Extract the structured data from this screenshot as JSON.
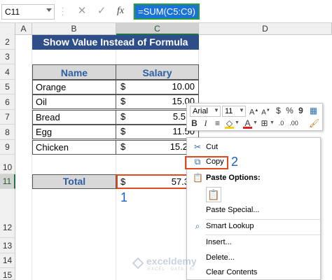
{
  "formula_bar": {
    "name_box": "C11",
    "formula": "=SUM(C5:C9)"
  },
  "columns": [
    "A",
    "B",
    "C",
    "D"
  ],
  "rows": [
    "1",
    "2",
    "3",
    "4",
    "5",
    "6",
    "7",
    "8",
    "9",
    "10",
    "11",
    "12",
    "13",
    "14",
    "15"
  ],
  "sheet": {
    "title": "Show Value Instead of Formula",
    "headers": {
      "name": "Name",
      "salary": "Salary"
    },
    "items": [
      {
        "name": "Orange",
        "currency": "$",
        "amount": "10.00"
      },
      {
        "name": "Oil",
        "currency": "$",
        "amount": "15.00"
      },
      {
        "name": "Bread",
        "currency": "$",
        "amount": "5.5"
      },
      {
        "name": "Egg",
        "currency": "$",
        "amount": "11.50"
      },
      {
        "name": "Chicken",
        "currency": "$",
        "amount": "15.2"
      }
    ],
    "total_label": "Total",
    "total_currency": "$",
    "total_amount": "57.3"
  },
  "annotations": {
    "step1": "1",
    "step2": "2"
  },
  "mini_toolbar": {
    "font": "Arial",
    "size": "11",
    "icons": [
      "increase-font-icon",
      "decrease-font-icon",
      "currency-icon",
      "percent-icon",
      "comma-style-icon",
      "format-table-icon",
      "bold-icon",
      "italic-icon",
      "align-center-icon",
      "fill-color-icon",
      "font-color-icon",
      "borders-icon",
      "increase-decimal-icon",
      "decrease-decimal-icon",
      "format-painter-icon"
    ]
  },
  "context_menu": {
    "cut": "Cut",
    "copy": "Copy",
    "paste_options": "Paste Options:",
    "paste_special": "Paste Special...",
    "smart_lookup": "Smart Lookup",
    "insert": "Insert...",
    "delete": "Delete...",
    "clear_contents": "Clear Contents"
  },
  "watermark": {
    "name": "exceldemy",
    "tagline": "EXCEL · DATA · BI"
  },
  "colors": {
    "title_bg": "#2e4e8a",
    "header_text": "#2e5fa4",
    "highlight_red": "#e04a1e",
    "annotation_blue": "#1a5fc4",
    "formula_highlight": "#1a73d9"
  }
}
